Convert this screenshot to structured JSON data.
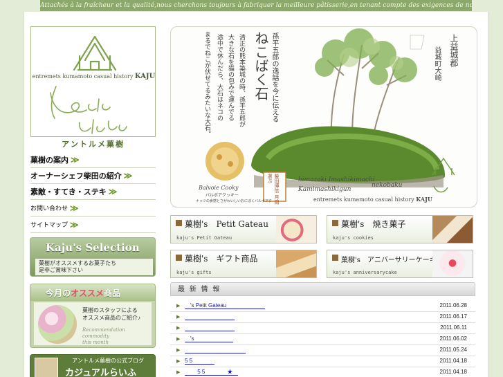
{
  "header": {
    "tagline": "Attachés à la fraîcheur et la qualité,nous cherchons toujours à fabriquer la meilleure pâtisserie,en tenant compte des exigences de nos clients."
  },
  "logo": {
    "en_small": "entremets kumamoto casual history",
    "en_brand": "KAJU",
    "script_line1": "entremets",
    "script_line2": "Kaju",
    "brand_jp": "アントルメ菓樹"
  },
  "nav": {
    "items": [
      {
        "label": "菓樹の案内"
      },
      {
        "label": "オーナーシェフ柴田の紹介"
      },
      {
        "label": "素敵・すてき・ステキ"
      },
      {
        "label": "お問い合わせ"
      },
      {
        "label": "サイトマップ"
      }
    ]
  },
  "side": {
    "selection": {
      "title": "Kaju's Selection",
      "sub_line1": "菓樹がオススメするお菓子たち",
      "sub_line2": "是非ご賞味下さい"
    },
    "recommend": {
      "title_prefix": "今月の",
      "title_highlight": "オススメ",
      "title_suffix": "商品",
      "text_line1": "菓樹のスタッフによる",
      "text_line2": "オススメ商品のご紹介♪",
      "en_line1": "Recommendation commodity",
      "en_line2": "this month"
    },
    "blog": {
      "small": "アントルメ菓樹の公式ブログ",
      "title": "カジュアルらいふ"
    }
  },
  "hero": {
    "col1": "上益城郡",
    "col2": "益城町大崎",
    "col3": "孫平五郎の逸話を今に伝える",
    "title": "ねこばく石",
    "col5": "清正の熊本築城の時、孫平五郎が",
    "col6": "大きな石を猫の包みで運んでる",
    "col7": "途中で休んだら、大石はネコの",
    "col8": "まるでねこが伏せてるみたいな大石。",
    "romaji": "himazaki Imashikimachi",
    "romaji2": "Kamimashikigun",
    "cat_word": "nekobaku",
    "en_small": "entremets kumamoto casual history",
    "en_brand": "KAJU",
    "stamp": "柴田博信 月間選ぶ",
    "food_label": "Balvoie Cooky",
    "food_label_jp": "バルボアクッキー",
    "food_caption": "ナッツの食感とさがわいしいおにぼくバルボアク"
  },
  "tiles": [
    {
      "title": "菓樹's　Petit Gateau",
      "en": "kaju's Petit Gateau"
    },
    {
      "title": "菓樹's　焼き菓子",
      "en": "kaju's cookies"
    },
    {
      "title": "菓樹's　ギフト商品",
      "en": "kaju's gifts"
    },
    {
      "title": "菓樹's　アニバーサリーケーキ",
      "en": "kaju's anniversarycake"
    }
  ],
  "news": {
    "heading": "最 新 情 報",
    "rows": [
      {
        "title": "　's Petit Gateau　　　　　　　",
        "date": "2011.06.28"
      },
      {
        "title": "　　　　　　　　　",
        "date": "2011.06.17"
      },
      {
        "title": "　　　　　　　　　",
        "date": "2011.06.11"
      },
      {
        "title": "　's　　　　　　　",
        "date": "2011.06.02"
      },
      {
        "title": "　　　　　　　　　　　",
        "date": "2011.05.24"
      },
      {
        "title": "5 5　　　　",
        "date": "2011.04.18"
      },
      {
        "title": "　　 5 5　　　　★　",
        "date": "2011.04.18"
      }
    ]
  },
  "colors": {
    "accent_green": "#6f9a2a",
    "link_blue": "#1a1ab8",
    "tagline_bg": "#8da86b"
  }
}
